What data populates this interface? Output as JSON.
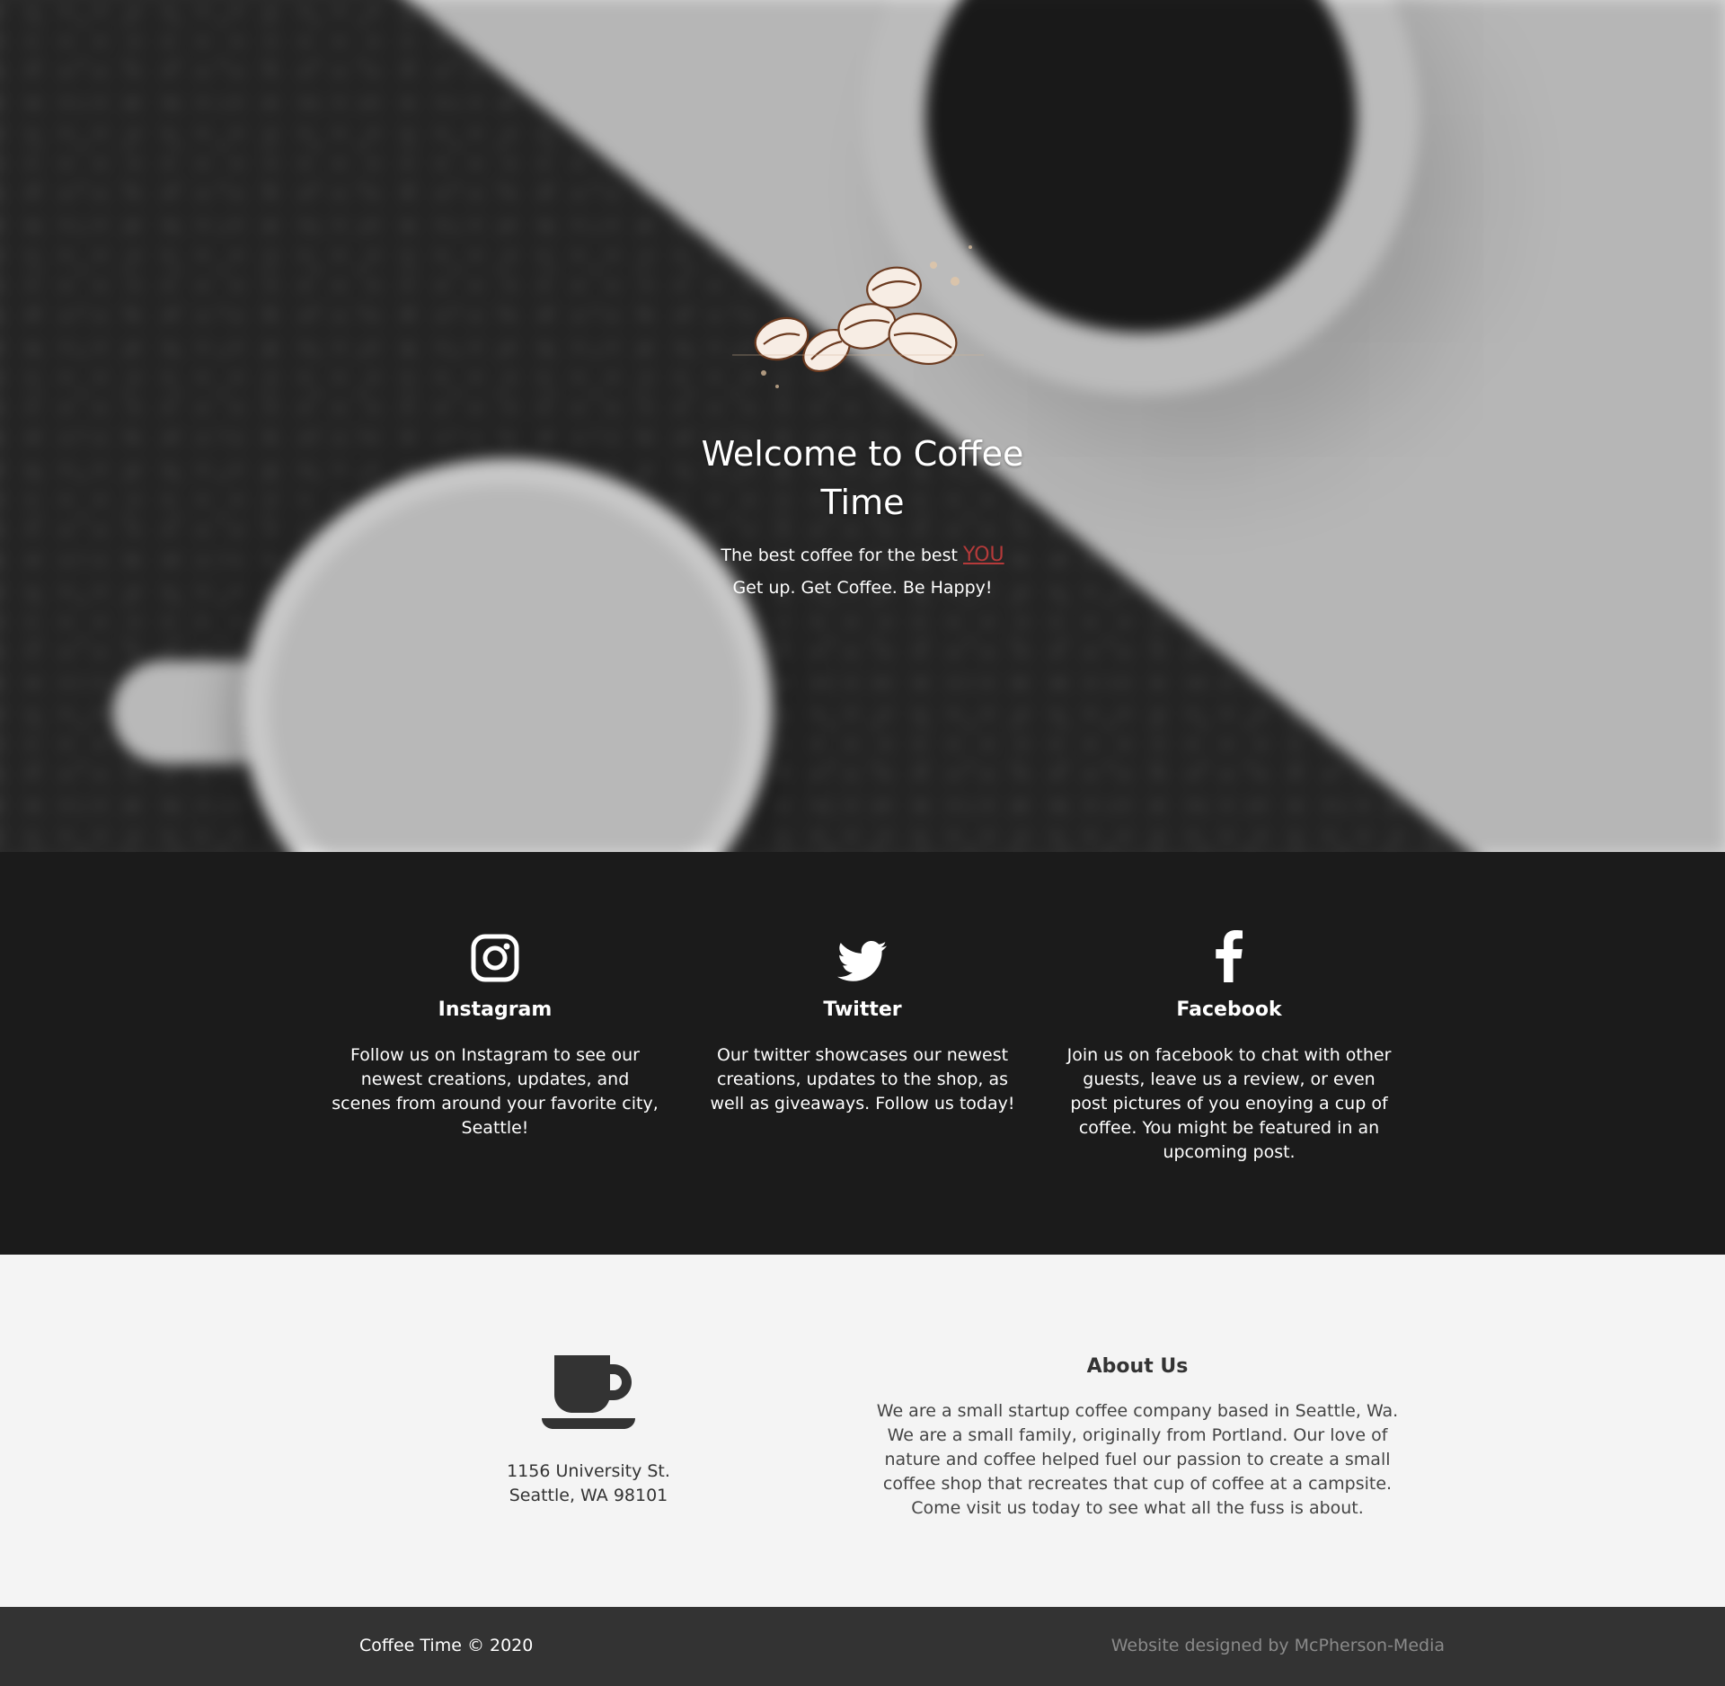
{
  "hero": {
    "title": "Welcome to Coffee Time",
    "tagline_prefix": "The best coffee for the best",
    "tagline_emphasis": "YOU",
    "subtagline": "Get up. Get Coffee. Be Happy!",
    "logo": "coffee-beans-sketch"
  },
  "social": [
    {
      "icon": "instagram-icon",
      "title": "Instagram",
      "text": "Follow us on Instagram to see our newest creations, updates, and scenes from around your favorite city, Seattle!"
    },
    {
      "icon": "twitter-icon",
      "title": "Twitter",
      "text": "Our twitter showcases our newest creations, updates to the shop, as well as giveaways. Follow us today!"
    },
    {
      "icon": "facebook-icon",
      "title": "Facebook",
      "text": "Join us on facebook to chat with other guests, leave us a review, or even post pictures of you enoying a cup of coffee. You might be featured in an upcoming post."
    }
  ],
  "about": {
    "icon": "coffee-cup-icon",
    "address_line1": "1156 University St.",
    "address_line2": "Seattle, WA 98101",
    "title": "About Us",
    "text": "We are a small startup coffee company based in Seattle, Wa. We are a small family, originally from Portland. Our love of nature and coffee helped fuel our passion to create a small coffee shop that recreates that cup of coffee at a campsite. Come visit us today to see what all the fuss is about."
  },
  "footer": {
    "copyright": "Coffee Time © 2020",
    "credit": "Website designed by McPherson-Media"
  },
  "colors": {
    "dark_section": "#1b1b1b",
    "footer": "#333333",
    "light_section": "#f4f4f4",
    "accent_red": "#b53a3a",
    "bean_brown": "#6b3a1f"
  }
}
